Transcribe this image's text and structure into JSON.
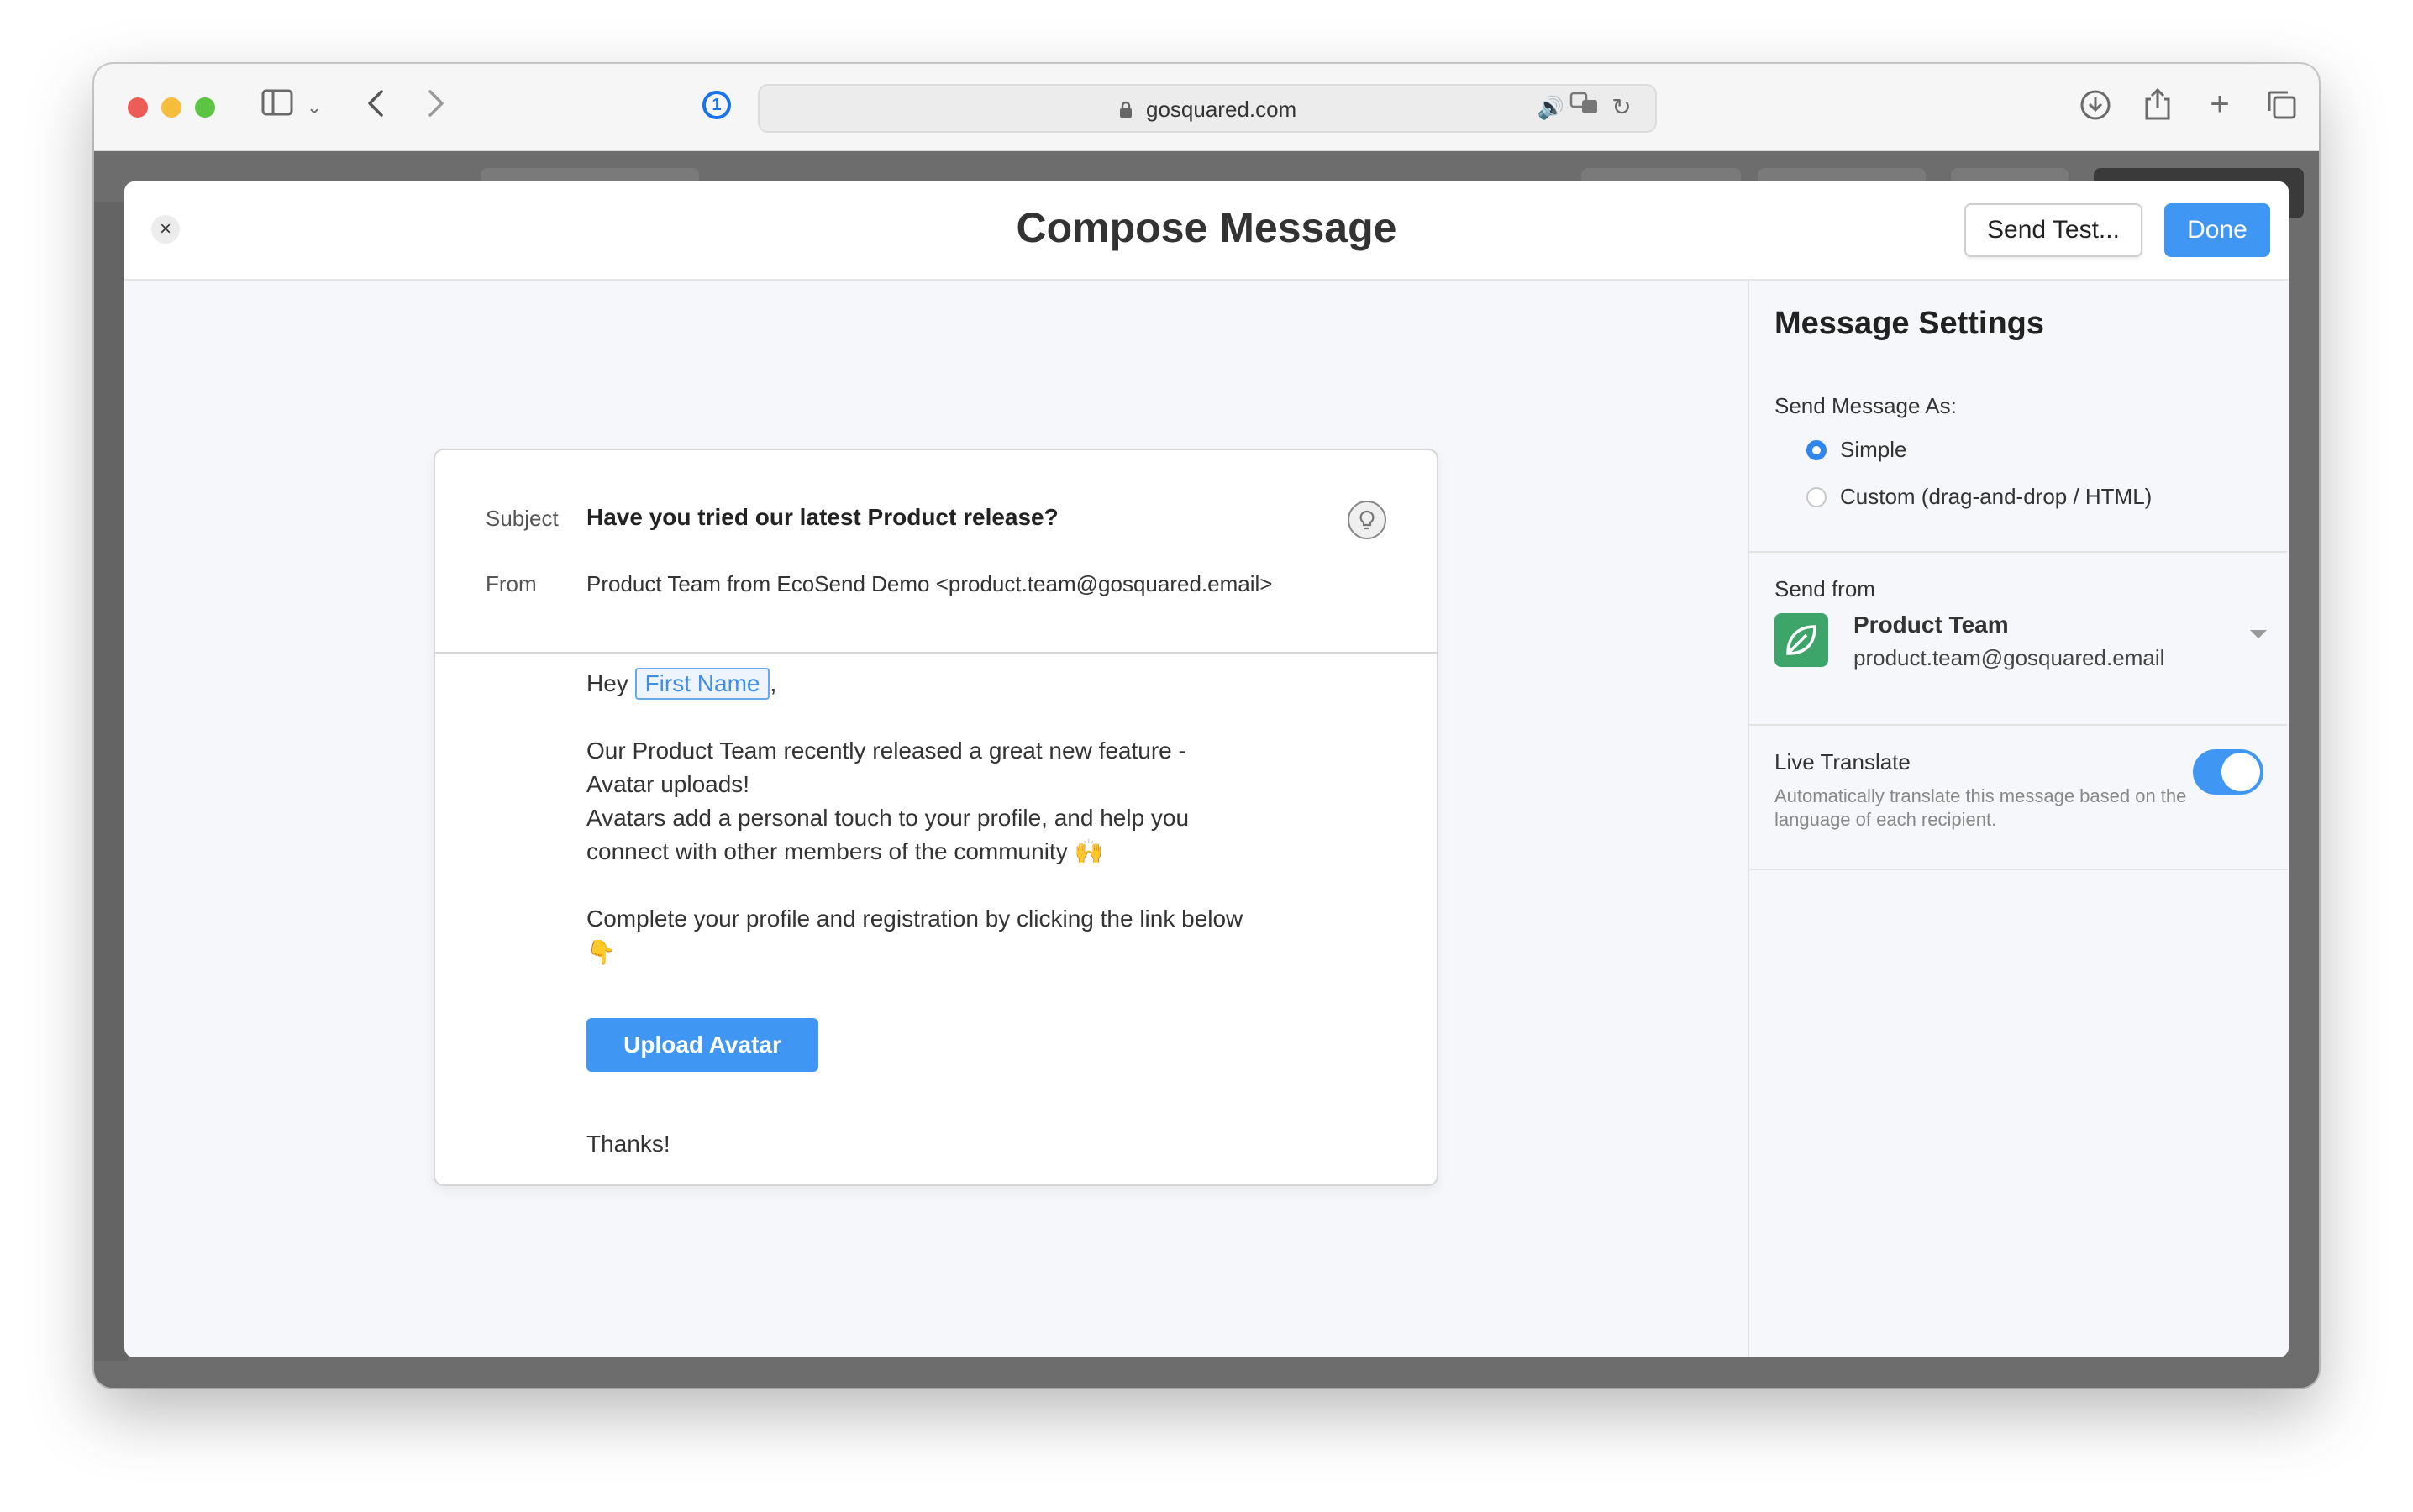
{
  "browser": {
    "url": "gosquared.com"
  },
  "modal": {
    "title": "Compose Message",
    "send_test_label": "Send Test...",
    "done_label": "Done",
    "close_icon": "×"
  },
  "email": {
    "subject_label": "Subject",
    "subject": "Have you tried our latest Product release?",
    "from_label": "From",
    "from": "Product Team from EcoSend Demo <product.team@gosquared.email>",
    "greeting": "Hey",
    "merge_tag": "First Name",
    "greeting_suffix": ",",
    "paragraph_1": "Our Product Team recently released a great new feature - Avatar uploads!",
    "paragraph_2": "Avatars add a personal touch to your profile, and help you connect with other members of the community 🙌",
    "paragraph_3": "Complete your profile and registration by clicking the link below 👇",
    "button_label": "Upload Avatar",
    "signoff": "Thanks!"
  },
  "settings": {
    "title": "Message Settings",
    "send_as_label": "Send Message As:",
    "options": [
      {
        "label": "Simple",
        "selected": true
      },
      {
        "label": "Custom (drag-and-drop / HTML)",
        "selected": false
      }
    ],
    "send_from_label": "Send from",
    "sender_name": "Product Team",
    "sender_email": "product.team@gosquared.email",
    "live_translate_label": "Live Translate",
    "live_translate_desc": "Automatically translate this message based on the language of each recipient.",
    "live_translate_on": true
  },
  "colors": {
    "accent": "#3f97f3",
    "sender_avatar": "#3ea56a"
  }
}
